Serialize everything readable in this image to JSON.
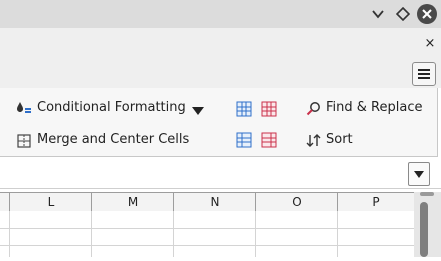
{
  "window": {
    "minimize_icon": "chevron-down-icon",
    "restore_icon": "diamond-icon",
    "close_icon": "close-icon"
  },
  "sidebar": {
    "close_glyph": "×",
    "menu_icon": "hamburger-icon"
  },
  "ribbon": {
    "conditional_formatting_label": "Conditional Formatting",
    "merge_label": "Merge and Center Cells",
    "find_replace_label": "Find & Replace",
    "sort_label": "Sort"
  },
  "columns": [
    "L",
    "M",
    "N",
    "O",
    "P"
  ],
  "colors": {
    "titlebar": "#dcdcdc",
    "ribbon_bg": "#f7f7f7",
    "icon_red": "#c9314b",
    "icon_blue": "#2f6fc9"
  }
}
